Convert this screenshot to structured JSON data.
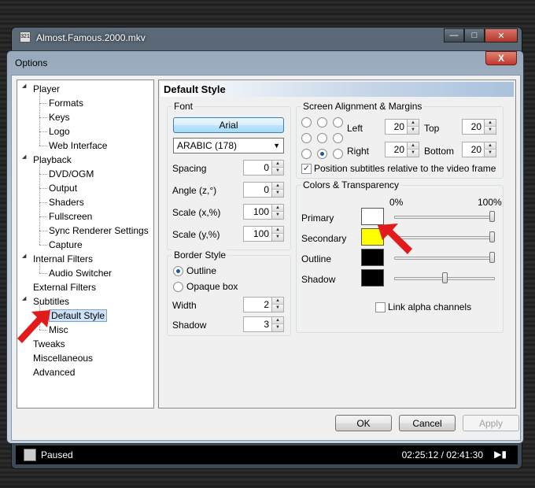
{
  "player": {
    "title": "Almost.Famous.2000.mkv",
    "icon_text": "321",
    "minimize_icon": "minimize-icon",
    "maximize_icon": "maximize-icon",
    "close_icon": "close-icon"
  },
  "dialog": {
    "title": "Options",
    "close_label": "X"
  },
  "tree": {
    "items": [
      {
        "label": "Player",
        "level": 0,
        "expanded": true
      },
      {
        "label": "Formats",
        "level": 1
      },
      {
        "label": "Keys",
        "level": 1
      },
      {
        "label": "Logo",
        "level": 1
      },
      {
        "label": "Web Interface",
        "level": 1
      },
      {
        "label": "Playback",
        "level": 0,
        "expanded": true
      },
      {
        "label": "DVD/OGM",
        "level": 1
      },
      {
        "label": "Output",
        "level": 1
      },
      {
        "label": "Shaders",
        "level": 1
      },
      {
        "label": "Fullscreen",
        "level": 1
      },
      {
        "label": "Sync Renderer Settings",
        "level": 1
      },
      {
        "label": "Capture",
        "level": 1
      },
      {
        "label": "Internal Filters",
        "level": 0,
        "expanded": true
      },
      {
        "label": "Audio Switcher",
        "level": 1
      },
      {
        "label": "External Filters",
        "level": 0
      },
      {
        "label": "Subtitles",
        "level": 0,
        "expanded": true
      },
      {
        "label": "Default Style",
        "level": 1,
        "selected": true
      },
      {
        "label": "Misc",
        "level": 1
      },
      {
        "label": "Tweaks",
        "level": 0
      },
      {
        "label": "Miscellaneous",
        "level": 0
      },
      {
        "label": "Advanced",
        "level": 0
      }
    ]
  },
  "page": {
    "header": "Default Style",
    "font": {
      "title": "Font",
      "font_button": "Arial",
      "charset": "ARABIC (178)",
      "spacing_label": "Spacing",
      "spacing": "0",
      "angle_label": "Angle (z,°)",
      "angle": "0",
      "scale_x_label": "Scale (x,%)",
      "scale_x": "100",
      "scale_y_label": "Scale (y,%)",
      "scale_y": "100"
    },
    "border": {
      "title": "Border Style",
      "outline_label": "Outline",
      "opaque_label": "Opaque box",
      "selected": "outline",
      "width_label": "Width",
      "width": "2",
      "shadow_label": "Shadow",
      "shadow": "3"
    },
    "alignment": {
      "title": "Screen Alignment & Margins",
      "selected_position": "bottom-center",
      "left_label": "Left",
      "left": "20",
      "top_label": "Top",
      "top": "20",
      "right_label": "Right",
      "right": "20",
      "bottom_label": "Bottom",
      "bottom": "20",
      "relative_label": "Position subtitles relative to the video frame",
      "relative_checked": true
    },
    "colors": {
      "title": "Colors & Transparency",
      "min_label": "0%",
      "max_label": "100%",
      "rows": [
        {
          "label": "Primary",
          "color": "#ffffff",
          "alpha": 1.0
        },
        {
          "label": "Secondary",
          "color": "#ffff00",
          "alpha": 1.0
        },
        {
          "label": "Outline",
          "color": "#000000",
          "alpha": 1.0
        },
        {
          "label": "Shadow",
          "color": "#000000",
          "alpha": 0.5
        }
      ],
      "link_label": "Link alpha channels",
      "link_checked": false
    }
  },
  "buttons": {
    "ok": "OK",
    "cancel": "Cancel",
    "apply": "Apply"
  },
  "status": {
    "state": "Paused",
    "time": "02:25:12 / 02:41:30"
  }
}
